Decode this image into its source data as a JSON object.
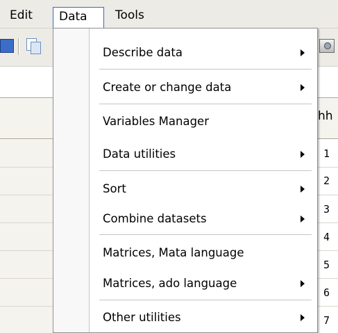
{
  "menubar": {
    "items": [
      "Edit",
      "Data",
      "Tools"
    ]
  },
  "toolbar": {
    "icons": [
      "save-icon",
      "copy-icon",
      "snapshot-icon"
    ]
  },
  "grid": {
    "partial_header": "hh",
    "row_numbers": [
      "1",
      "2",
      "3",
      "4",
      "5",
      "6",
      "7"
    ]
  },
  "data_menu": {
    "items": [
      {
        "label": "Describe data",
        "submenu": true
      },
      {
        "label": "Create or change data",
        "submenu": true
      },
      {
        "label": "Variables Manager",
        "submenu": false
      },
      {
        "label": "Data utilities",
        "submenu": true
      },
      {
        "label": "Sort",
        "submenu": true
      },
      {
        "label": "Combine datasets",
        "submenu": true
      },
      {
        "label": "Matrices, Mata language",
        "submenu": false
      },
      {
        "label": "Matrices, ado language",
        "submenu": true
      },
      {
        "label": "Other utilities",
        "submenu": true
      }
    ]
  },
  "colors": {
    "menubar_bg": "#ecebe6",
    "highlight_border": "#316ac5",
    "menu_bg": "#ffffff"
  }
}
